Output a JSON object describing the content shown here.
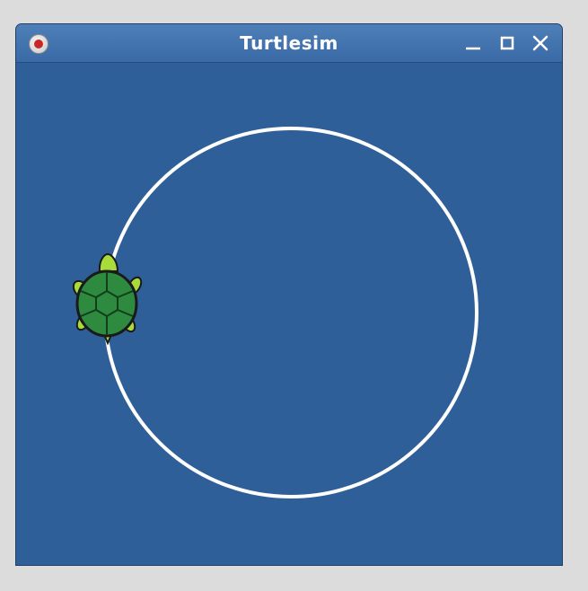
{
  "window": {
    "title": "Turtlesim"
  },
  "titlebar": {
    "record_icon": "record-dot-icon",
    "minimize_icon": "minimize-icon",
    "maximize_icon": "maximize-icon",
    "close_icon": "close-icon"
  },
  "canvas": {
    "background_color": "#2e5f99",
    "pen_color": "#ffffff",
    "trail_shape": "circle",
    "turtle_icon": "turtle-icon"
  }
}
